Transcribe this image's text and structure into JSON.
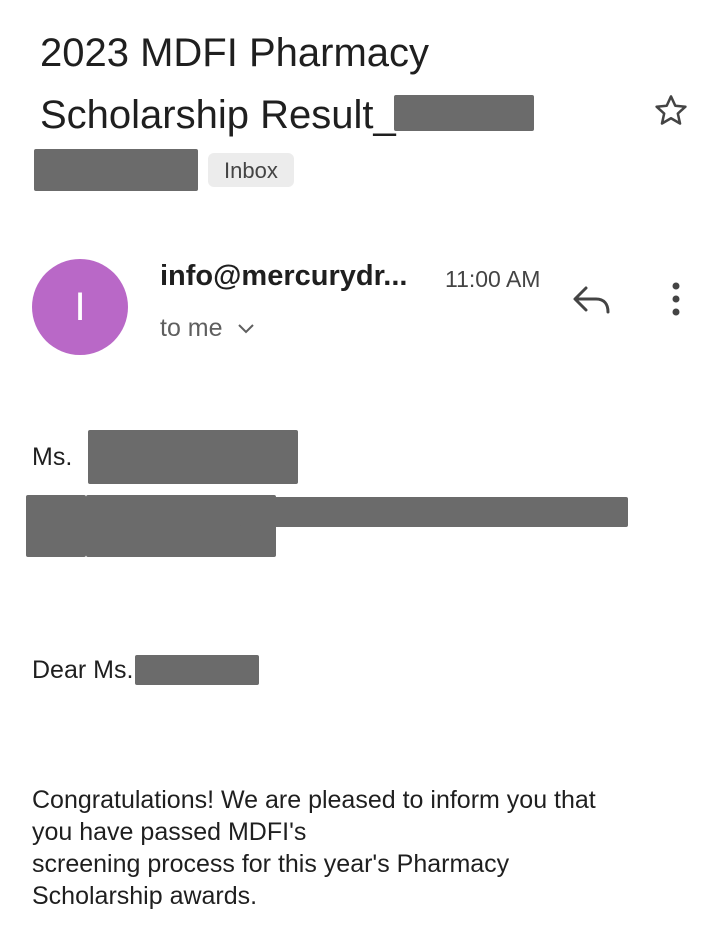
{
  "email": {
    "subject_line1": "2023 MDFI Pharmacy",
    "subject_line2": "Scholarship Result_",
    "label": "Inbox",
    "avatar_letter": "I",
    "sender": "info@mercurydr...",
    "time": "11:00 AM",
    "recipient": "to me",
    "salutation": "Ms.",
    "dear": "Dear Ms.",
    "body_lines": [
      "Congratulations! We are pleased to inform you that",
      "you have passed MDFI's",
      "screening process for this year's Pharmacy",
      "Scholarship awards."
    ]
  },
  "icons": {
    "star": "star-icon",
    "reply": "reply-icon",
    "more": "more-vert-icon",
    "chevron": "chevron-down-icon"
  },
  "colors": {
    "avatar": "#b968c7",
    "redaction": "#6b6b6b",
    "chip": "#ececec"
  }
}
